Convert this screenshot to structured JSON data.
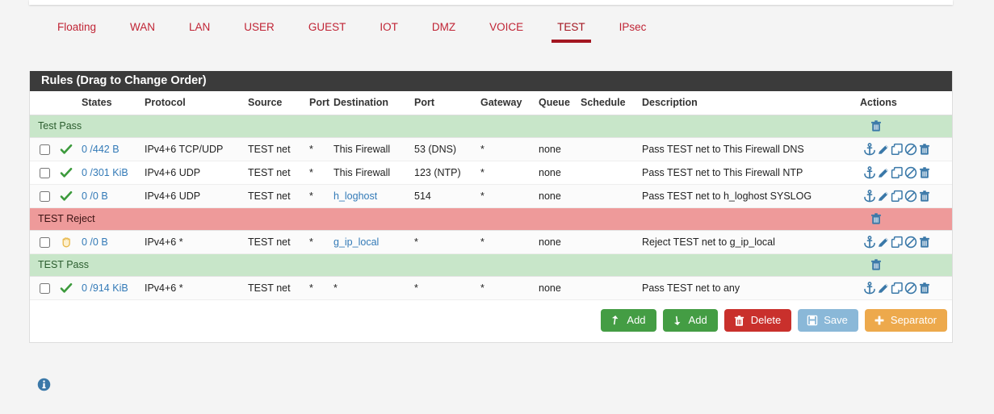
{
  "tabs": [
    {
      "label": "Floating",
      "active": false
    },
    {
      "label": "WAN",
      "active": false
    },
    {
      "label": "LAN",
      "active": false
    },
    {
      "label": "USER",
      "active": false
    },
    {
      "label": "GUEST",
      "active": false
    },
    {
      "label": "IOT",
      "active": false
    },
    {
      "label": "DMZ",
      "active": false
    },
    {
      "label": "VOICE",
      "active": false
    },
    {
      "label": "TEST",
      "active": true
    },
    {
      "label": "IPsec",
      "active": false
    }
  ],
  "panel": {
    "heading": "Rules (Drag to Change Order)",
    "columns": [
      "",
      "",
      "States",
      "Protocol",
      "Source",
      "Port",
      "Destination",
      "Port",
      "Gateway",
      "Queue",
      "Schedule",
      "Description",
      "Actions"
    ]
  },
  "rows": [
    {
      "kind": "separator",
      "color": "green",
      "label": "Test Pass"
    },
    {
      "kind": "rule",
      "state_icon": "check-icon",
      "states": "0 /442 B",
      "protocol": "IPv4+6 TCP/UDP",
      "source": "TEST net",
      "source_port": "*",
      "destination": "This Firewall",
      "destination_link": false,
      "destination_port": "53 (DNS)",
      "gateway": "*",
      "queue": "none",
      "schedule": "",
      "description": "Pass TEST net to This Firewall DNS"
    },
    {
      "kind": "rule",
      "state_icon": "check-icon",
      "states": "0 /301 KiB",
      "protocol": "IPv4+6 UDP",
      "source": "TEST net",
      "source_port": "*",
      "destination": "This Firewall",
      "destination_link": false,
      "destination_port": "123 (NTP)",
      "gateway": "*",
      "queue": "none",
      "schedule": "",
      "description": "Pass TEST net to This Firewall NTP"
    },
    {
      "kind": "rule",
      "state_icon": "check-icon",
      "states": "0 /0 B",
      "protocol": "IPv4+6 UDP",
      "source": "TEST net",
      "source_port": "*",
      "destination": "h_loghost",
      "destination_link": true,
      "destination_port": "514",
      "gateway": "*",
      "queue": "none",
      "schedule": "",
      "description": "Pass TEST net to h_loghost SYSLOG"
    },
    {
      "kind": "separator",
      "color": "red",
      "label": "TEST Reject"
    },
    {
      "kind": "rule",
      "state_icon": "hand-reject-icon",
      "states": "0 /0 B",
      "protocol": "IPv4+6 *",
      "source": "TEST net",
      "source_port": "*",
      "destination": "g_ip_local",
      "destination_link": true,
      "destination_port": "*",
      "gateway": "*",
      "queue": "none",
      "schedule": "",
      "description": "Reject TEST net to g_ip_local"
    },
    {
      "kind": "separator",
      "color": "green",
      "label": "TEST Pass"
    },
    {
      "kind": "rule",
      "state_icon": "check-icon",
      "states": "0 /914 KiB",
      "protocol": "IPv4+6 *",
      "source": "TEST net",
      "source_port": "*",
      "destination": "*",
      "destination_link": false,
      "destination_port": "*",
      "gateway": "*",
      "queue": "none",
      "schedule": "",
      "description": "Pass TEST net to any"
    }
  ],
  "row_actions": [
    {
      "name": "anchor-icon",
      "title": "Move"
    },
    {
      "name": "pencil-icon",
      "title": "Edit"
    },
    {
      "name": "copy-icon",
      "title": "Copy"
    },
    {
      "name": "ban-icon",
      "title": "Disable"
    },
    {
      "name": "trash-icon",
      "title": "Delete"
    }
  ],
  "buttons": [
    {
      "label": "Add",
      "icon": "arrow-up-icon",
      "style": "btn-green",
      "name": "add-rule-up-button"
    },
    {
      "label": "Add",
      "icon": "arrow-down-icon",
      "style": "btn-green",
      "name": "add-rule-down-button"
    },
    {
      "label": "Delete",
      "icon": "trash-icon",
      "style": "btn-red",
      "name": "delete-button"
    },
    {
      "label": "Save",
      "icon": "floppy-icon",
      "style": "btn-blue",
      "name": "save-button"
    },
    {
      "label": "Separator",
      "icon": "plus-icon",
      "style": "btn-orange",
      "name": "add-separator-button"
    }
  ],
  "footer": {
    "info_icon": "info-circle-icon"
  },
  "colors": {
    "brand_red": "#a31621",
    "tab_text": "#c02435",
    "heading_bg": "#3b3b3b",
    "separator_green": "#c8e6c9",
    "separator_red": "#ee9a9a",
    "link_blue": "#337ab7",
    "icon_blue": "#3a78a8",
    "pass_green": "#3c9a3c",
    "reject_amber": "#e8b84b"
  }
}
